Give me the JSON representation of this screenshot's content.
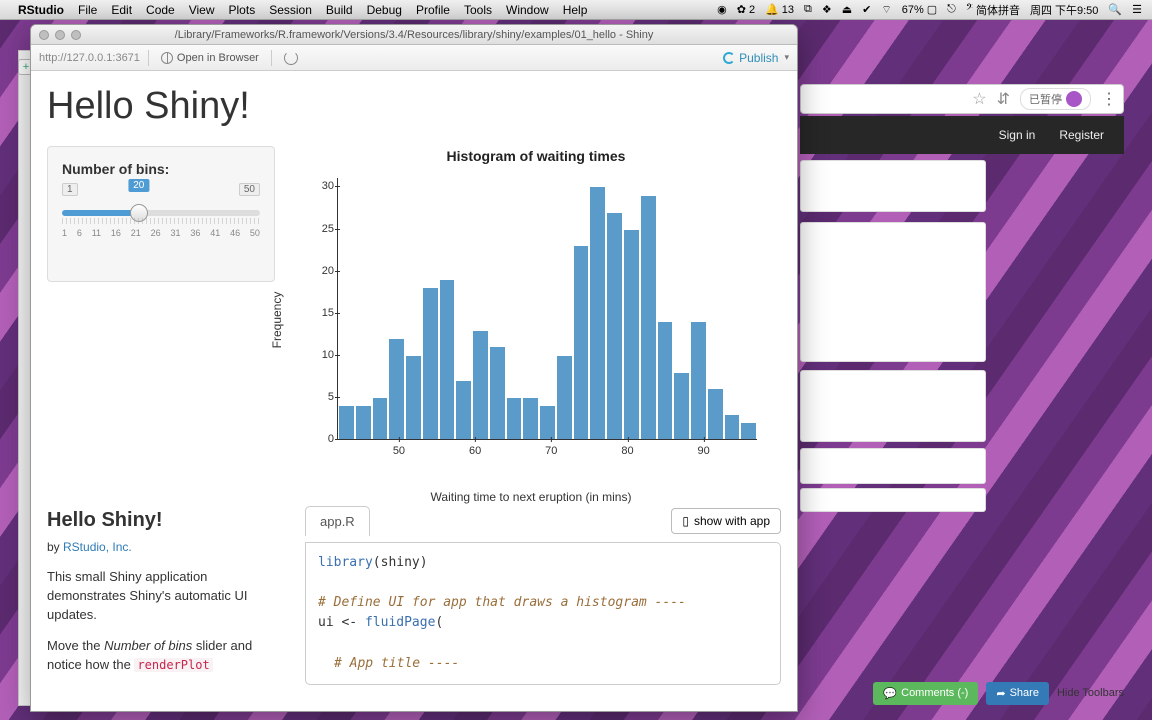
{
  "menubar": {
    "app": "RStudio",
    "items": [
      "File",
      "Edit",
      "Code",
      "View",
      "Plots",
      "Session",
      "Build",
      "Debug",
      "Profile",
      "Tools",
      "Window",
      "Help"
    ],
    "right": {
      "badge1": "2",
      "badge2": "13",
      "battery": "67%",
      "ime": "简体拼音",
      "clock": "周四 下午9:50"
    }
  },
  "viewer": {
    "title": "/Library/Frameworks/R.framework/Versions/3.4/Resources/library/shiny/examples/01_hello - Shiny",
    "url": "http://127.0.0.1:3671",
    "open_browser": "Open in Browser",
    "publish": "Publish"
  },
  "app": {
    "title": "Hello Shiny!",
    "slider": {
      "label": "Number of bins:",
      "min": 1,
      "max": 50,
      "value": 20,
      "bottom_ticks": [
        "1",
        "6",
        "11",
        "16",
        "21",
        "26",
        "31",
        "36",
        "41",
        "46",
        "50"
      ]
    }
  },
  "chart_data": {
    "type": "bar",
    "title": "Histogram of waiting times",
    "xlabel": "Waiting time to next eruption (in mins)",
    "ylabel": "Frequency",
    "ylim": [
      0,
      31
    ],
    "yticks": [
      0,
      5,
      10,
      15,
      20,
      25,
      30
    ],
    "xticks": [
      50,
      60,
      70,
      80,
      90
    ],
    "bin_edges": [
      42,
      44.75,
      47.5,
      50.25,
      53,
      55.75,
      58.5,
      61.25,
      64,
      66.75,
      69.5,
      72.25,
      75,
      77.75,
      80.5,
      83.25,
      86,
      88.75,
      91.5,
      94.25,
      97
    ],
    "values": [
      4,
      4,
      5,
      12,
      10,
      18,
      19,
      7,
      13,
      11,
      5,
      5,
      4,
      10,
      23,
      30,
      27,
      25,
      29,
      14,
      8,
      14,
      6,
      3,
      2
    ]
  },
  "about": {
    "heading": "Hello Shiny!",
    "by_prefix": "by ",
    "by_link": "RStudio, Inc.",
    "p1": "This small Shiny application demonstrates Shiny's automatic UI updates.",
    "p2_a": "Move the ",
    "p2_i": "Number of bins",
    "p2_b": " slider and notice how the ",
    "p2_code": "renderPlot"
  },
  "code": {
    "tab": "app.R",
    "show": "show with app",
    "lines": {
      "l1a": "library",
      "l1b": "(shiny)",
      "l2": "# Define UI for app that draws a histogram ----",
      "l3a": "ui <- ",
      "l3b": "fluidPage",
      "l3c": "(",
      "l4": "# App title ----"
    }
  },
  "bg": {
    "paused": "已暂停",
    "signin": "Sign in",
    "register": "Register",
    "comments": "Comments (-)",
    "share": "Share",
    "hide": "Hide Toolbars"
  }
}
